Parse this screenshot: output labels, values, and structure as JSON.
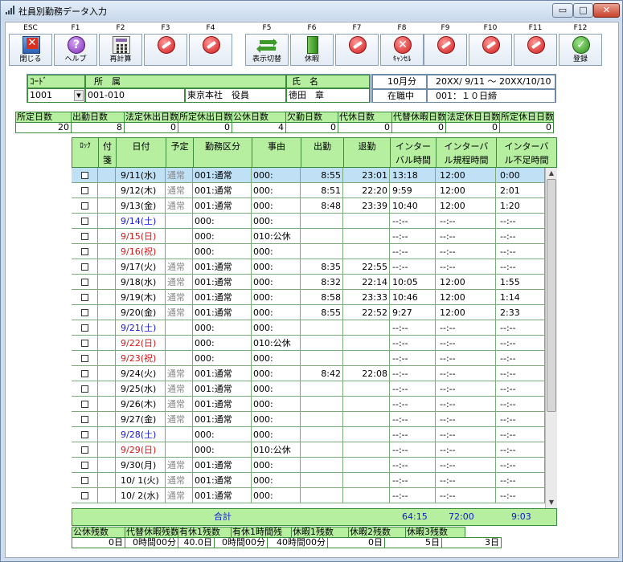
{
  "window": {
    "title": "社員別勤務データ入力",
    "min_glyph": "▭",
    "max_glyph": "□",
    "close_glyph": "✕"
  },
  "toolbar": [
    {
      "key": "ESC",
      "label": "閉じる",
      "icon": "close-app-icon"
    },
    {
      "key": "F1",
      "label": "ヘルプ",
      "icon": "help-icon",
      "glyph": "?"
    },
    {
      "key": "F2",
      "label": "再計算",
      "icon": "calculator-icon"
    },
    {
      "key": "F3",
      "label": "",
      "icon": "disabled-icon"
    },
    {
      "key": "F4",
      "label": "",
      "icon": "disabled-icon"
    },
    {
      "key": "F5",
      "label": "表示切替",
      "icon": "switch-arrows-icon"
    },
    {
      "key": "F6",
      "label": "休暇",
      "icon": "leave-icon"
    },
    {
      "key": "F7",
      "label": "",
      "icon": "disabled-icon"
    },
    {
      "key": "F8",
      "label": "ｷｬﾝｾﾙ",
      "icon": "cancel-icon",
      "glyph": "✕"
    },
    {
      "key": "F9",
      "label": "",
      "icon": "disabled-icon"
    },
    {
      "key": "F10",
      "label": "",
      "icon": "disabled-icon"
    },
    {
      "key": "F11",
      "label": "",
      "icon": "disabled-icon"
    },
    {
      "key": "F12",
      "label": "登録",
      "icon": "confirm-icon",
      "glyph": "✓"
    }
  ],
  "employee": {
    "code_label": "ｺｰﾄﾞ",
    "dept_label": "所　属",
    "name_label": "氏　名",
    "code": "1001",
    "dept_code": "001-010",
    "dept_name": "東京本社　役員",
    "name": "徳田　章"
  },
  "period": {
    "month": "10月分",
    "range": "20XX/ 9/11 〜 20XX/10/10",
    "status": "在職中",
    "closing": "001：１０日締"
  },
  "summary": {
    "labels": [
      "所定日数",
      "出勤日数",
      "法定休出日数",
      "所定休出日数",
      "公休日数",
      "欠勤日数",
      "代休日数",
      "代替休暇日数",
      "法定休日日数",
      "所定休日日数"
    ],
    "values": [
      "20",
      "8",
      "0",
      "0",
      "4",
      "0",
      "0",
      "0",
      "0",
      "0"
    ]
  },
  "grid": {
    "headers": [
      "ﾛｯｸ",
      "付箋",
      "日付",
      "予定",
      "勤務区分",
      "事由",
      "出勤",
      "退勤",
      "インターバル時間",
      "インターバル規程時間",
      "インターバル不足時間"
    ],
    "header_lines": [
      [
        "ﾛｯｸ"
      ],
      [
        "付",
        "箋"
      ],
      [
        "日付"
      ],
      [
        "予定"
      ],
      [
        "勤務区分"
      ],
      [
        "事由"
      ],
      [
        "出勤"
      ],
      [
        "退勤"
      ],
      [
        "インター",
        "バル時間"
      ],
      [
        "インターバ",
        "ル規程時間"
      ],
      [
        "インターバ",
        "ル不足時間"
      ]
    ],
    "rows": [
      {
        "date": "9/11(水)",
        "type": "weekday",
        "plan": "通常",
        "kubun": "001:通常",
        "jiyu": "000:",
        "in": "8:55",
        "out": "23:01",
        "iv": "13:18",
        "rule": "12:00",
        "short": "0:00",
        "selected": true
      },
      {
        "date": "9/12(木)",
        "type": "weekday",
        "plan": "通常",
        "kubun": "001:通常",
        "jiyu": "000:",
        "in": "8:51",
        "out": "22:20",
        "iv": " 9:59",
        "rule": "12:00",
        "short": "2:01"
      },
      {
        "date": "9/13(金)",
        "type": "weekday",
        "plan": "通常",
        "kubun": "001:通常",
        "jiyu": "000:",
        "in": "8:48",
        "out": "23:39",
        "iv": "10:40",
        "rule": "12:00",
        "short": "1:20"
      },
      {
        "date": "9/14(土)",
        "type": "sat",
        "plan": "",
        "kubun": "000:",
        "jiyu": "000:",
        "in": "",
        "out": "",
        "iv": "--:--",
        "rule": "--:--",
        "short": "--:--"
      },
      {
        "date": "9/15(日)",
        "type": "sun",
        "plan": "",
        "kubun": "000:",
        "jiyu": "010:公休",
        "in": "",
        "out": "",
        "iv": "--:--",
        "rule": "--:--",
        "short": "--:--"
      },
      {
        "date": "9/16(祝)",
        "type": "sun",
        "plan": "",
        "kubun": "000:",
        "jiyu": "000:",
        "in": "",
        "out": "",
        "iv": "--:--",
        "rule": "--:--",
        "short": "--:--"
      },
      {
        "date": "9/17(火)",
        "type": "weekday",
        "plan": "通常",
        "kubun": "001:通常",
        "jiyu": "000:",
        "in": "8:35",
        "out": "22:55",
        "iv": "--:--",
        "rule": "--:--",
        "short": "--:--"
      },
      {
        "date": "9/18(水)",
        "type": "weekday",
        "plan": "通常",
        "kubun": "001:通常",
        "jiyu": "000:",
        "in": "8:32",
        "out": "22:14",
        "iv": "10:05",
        "rule": "12:00",
        "short": "1:55"
      },
      {
        "date": "9/19(木)",
        "type": "weekday",
        "plan": "通常",
        "kubun": "001:通常",
        "jiyu": "000:",
        "in": "8:58",
        "out": "23:33",
        "iv": "10:46",
        "rule": "12:00",
        "short": "1:14"
      },
      {
        "date": "9/20(金)",
        "type": "weekday",
        "plan": "通常",
        "kubun": "001:通常",
        "jiyu": "000:",
        "in": "8:55",
        "out": "22:52",
        "iv": " 9:27",
        "rule": "12:00",
        "short": "2:33"
      },
      {
        "date": "9/21(土)",
        "type": "sat",
        "plan": "",
        "kubun": "000:",
        "jiyu": "000:",
        "in": "",
        "out": "",
        "iv": "--:--",
        "rule": "--:--",
        "short": "--:--"
      },
      {
        "date": "9/22(日)",
        "type": "sun",
        "plan": "",
        "kubun": "000:",
        "jiyu": "010:公休",
        "in": "",
        "out": "",
        "iv": "--:--",
        "rule": "--:--",
        "short": "--:--"
      },
      {
        "date": "9/23(祝)",
        "type": "sun",
        "plan": "",
        "kubun": "000:",
        "jiyu": "000:",
        "in": "",
        "out": "",
        "iv": "--:--",
        "rule": "--:--",
        "short": "--:--"
      },
      {
        "date": "9/24(火)",
        "type": "weekday",
        "plan": "通常",
        "kubun": "001:通常",
        "jiyu": "000:",
        "in": "8:42",
        "out": "22:08",
        "iv": "--:--",
        "rule": "--:--",
        "short": "--:--"
      },
      {
        "date": "9/25(水)",
        "type": "weekday",
        "plan": "通常",
        "kubun": "001:通常",
        "jiyu": "000:",
        "in": "",
        "out": "",
        "iv": "--:--",
        "rule": "--:--",
        "short": "--:--"
      },
      {
        "date": "9/26(木)",
        "type": "weekday",
        "plan": "通常",
        "kubun": "001:通常",
        "jiyu": "000:",
        "in": "",
        "out": "",
        "iv": "--:--",
        "rule": "--:--",
        "short": "--:--"
      },
      {
        "date": "9/27(金)",
        "type": "weekday",
        "plan": "通常",
        "kubun": "001:通常",
        "jiyu": "000:",
        "in": "",
        "out": "",
        "iv": "--:--",
        "rule": "--:--",
        "short": "--:--"
      },
      {
        "date": "9/28(土)",
        "type": "sat",
        "plan": "",
        "kubun": "000:",
        "jiyu": "000:",
        "in": "",
        "out": "",
        "iv": "--:--",
        "rule": "--:--",
        "short": "--:--"
      },
      {
        "date": "9/29(日)",
        "type": "sun",
        "plan": "",
        "kubun": "000:",
        "jiyu": "010:公休",
        "in": "",
        "out": "",
        "iv": "--:--",
        "rule": "--:--",
        "short": "--:--"
      },
      {
        "date": "9/30(月)",
        "type": "weekday",
        "plan": "通常",
        "kubun": "001:通常",
        "jiyu": "000:",
        "in": "",
        "out": "",
        "iv": "--:--",
        "rule": "--:--",
        "short": "--:--"
      },
      {
        "date": "10/ 1(火)",
        "type": "weekday",
        "plan": "通常",
        "kubun": "001:通常",
        "jiyu": "000:",
        "in": "",
        "out": "",
        "iv": "--:--",
        "rule": "--:--",
        "short": "--:--"
      },
      {
        "date": "10/ 2(水)",
        "type": "weekday",
        "plan": "通常",
        "kubun": "001:通常",
        "jiyu": "000:",
        "in": "",
        "out": "",
        "iv": "--:--",
        "rule": "--:--",
        "short": "--:--"
      }
    ],
    "totals": {
      "label": "合計",
      "iv": "64:15",
      "rule": "72:00",
      "short": "9:03"
    }
  },
  "balances": {
    "labels": [
      "公休残数",
      "代替休暇残数",
      "有休1残数",
      "有休1時間残",
      "休暇1残数",
      "休暇2残数",
      "休暇3残数"
    ],
    "values": [
      "0日",
      "0時間00分",
      "40.0日",
      "0時間00分",
      "40時間00分",
      "0日",
      "5日",
      "3日"
    ]
  },
  "colors": {
    "header_green": "#b5ef9f",
    "selected_row": "#bfe0f5",
    "saturday_blue": "#1515d6",
    "sunday_red": "#d61515"
  }
}
